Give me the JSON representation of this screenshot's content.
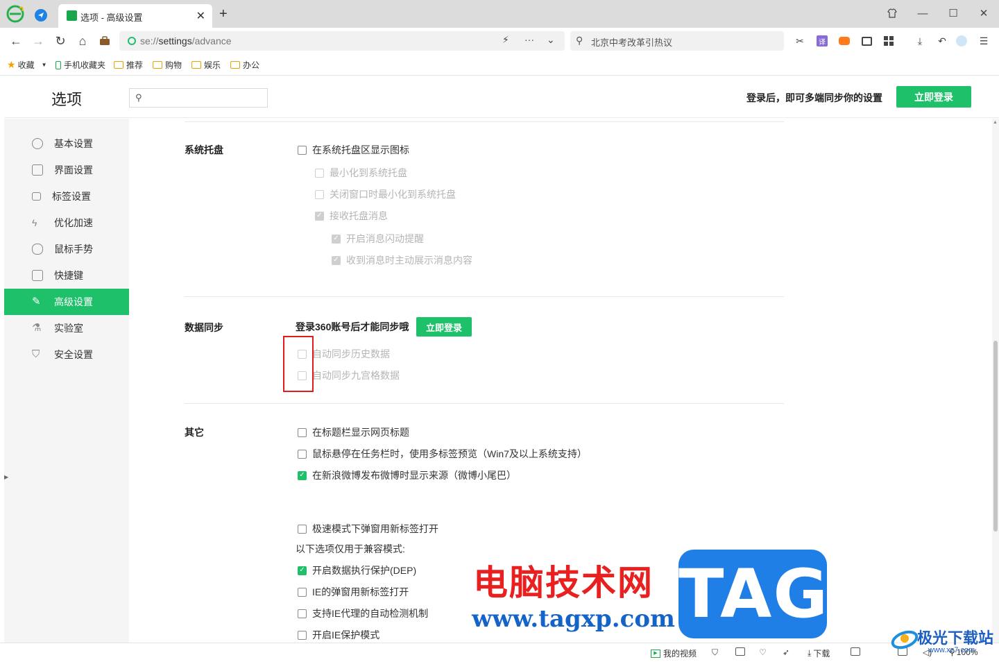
{
  "browser": {
    "tab_title": "选项 - 高级设置",
    "url_scheme": "se://",
    "url_host": "settings",
    "url_path": "/advance",
    "search_text": "北京中考改革引热议"
  },
  "bookmarks": [
    {
      "label": "收藏",
      "icon": "star-icon"
    },
    {
      "label": "手机收藏夹",
      "icon": "phone-icon"
    },
    {
      "label": "推荐",
      "icon": "folder-icon"
    },
    {
      "label": "购物",
      "icon": "folder-icon"
    },
    {
      "label": "娱乐",
      "icon": "folder-icon"
    },
    {
      "label": "办公",
      "icon": "folder-icon"
    }
  ],
  "header": {
    "title": "选项",
    "search_placeholder": "",
    "login_tip": "登录后，即可多端同步你的设置",
    "login_button": "立即登录"
  },
  "sidebar": {
    "items": [
      {
        "label": "基本设置",
        "icon": "settings-circle-icon",
        "active": false
      },
      {
        "label": "界面设置",
        "icon": "window-icon",
        "active": false
      },
      {
        "label": "标签设置",
        "icon": "tab-icon",
        "active": false
      },
      {
        "label": "优化加速",
        "icon": "lightning-icon",
        "active": false
      },
      {
        "label": "鼠标手势",
        "icon": "mouse-icon",
        "active": false
      },
      {
        "label": "快捷键",
        "icon": "keyboard-icon",
        "active": false
      },
      {
        "label": "高级设置",
        "icon": "wrench-icon",
        "active": true
      },
      {
        "label": "实验室",
        "icon": "flask-icon",
        "active": false
      },
      {
        "label": "安全设置",
        "icon": "shield-icon",
        "active": false
      }
    ]
  },
  "sections": {
    "tray": {
      "title": "系统托盘",
      "options": [
        {
          "label": "在系统托盘区显示图标",
          "checked": false,
          "disabled": false
        },
        {
          "label": "最小化到系统托盘",
          "checked": false,
          "disabled": true
        },
        {
          "label": "关闭窗口时最小化到系统托盘",
          "checked": false,
          "disabled": true
        },
        {
          "label": "接收托盘消息",
          "checked": true,
          "disabled": true
        },
        {
          "label": "开启消息闪动提醒",
          "checked": true,
          "disabled": true
        },
        {
          "label": "收到消息时主动展示消息内容",
          "checked": true,
          "disabled": true
        }
      ]
    },
    "sync": {
      "title": "数据同步",
      "tip": "登录360账号后才能同步哦",
      "login_button": "立即登录",
      "options": [
        {
          "label": "自动同步历史数据",
          "checked": false,
          "disabled": true
        },
        {
          "label": "自动同步九宫格数据",
          "checked": false,
          "disabled": true
        }
      ]
    },
    "other": {
      "title": "其它",
      "options": [
        {
          "label": "在标题栏显示网页标题",
          "checked": false
        },
        {
          "label": "鼠标悬停在任务栏时，使用多标签预览（Win7及以上系统支持）",
          "checked": false
        },
        {
          "label": "在新浪微博发布微博时显示来源（微博小尾巴）",
          "checked": true
        },
        {
          "label": "极速模式下弹窗用新标签打开",
          "checked": false
        }
      ],
      "compat_label": "以下选项仅用于兼容模式:",
      "compat_options": [
        {
          "label": "开启数据执行保护(DEP)",
          "checked": true
        },
        {
          "label": "IE的弹窗用新标签打开",
          "checked": false
        },
        {
          "label": "支持IE代理的自动检测机制",
          "checked": false
        },
        {
          "label": "开启IE保护模式",
          "checked": false
        }
      ]
    }
  },
  "statusbar": {
    "my_video": "我的视频",
    "download": "下载",
    "zoom": "100%"
  },
  "watermark": {
    "cn": "电脑技术网",
    "url": "www.tagxp.com",
    "tag": "TAG",
    "brand": "极光下载站",
    "brand_url": "www.xz7.com"
  },
  "colors": {
    "accent": "#1ec06a",
    "highlight": "#e21c1c",
    "sidebar_bg": "#f5f5f5"
  }
}
